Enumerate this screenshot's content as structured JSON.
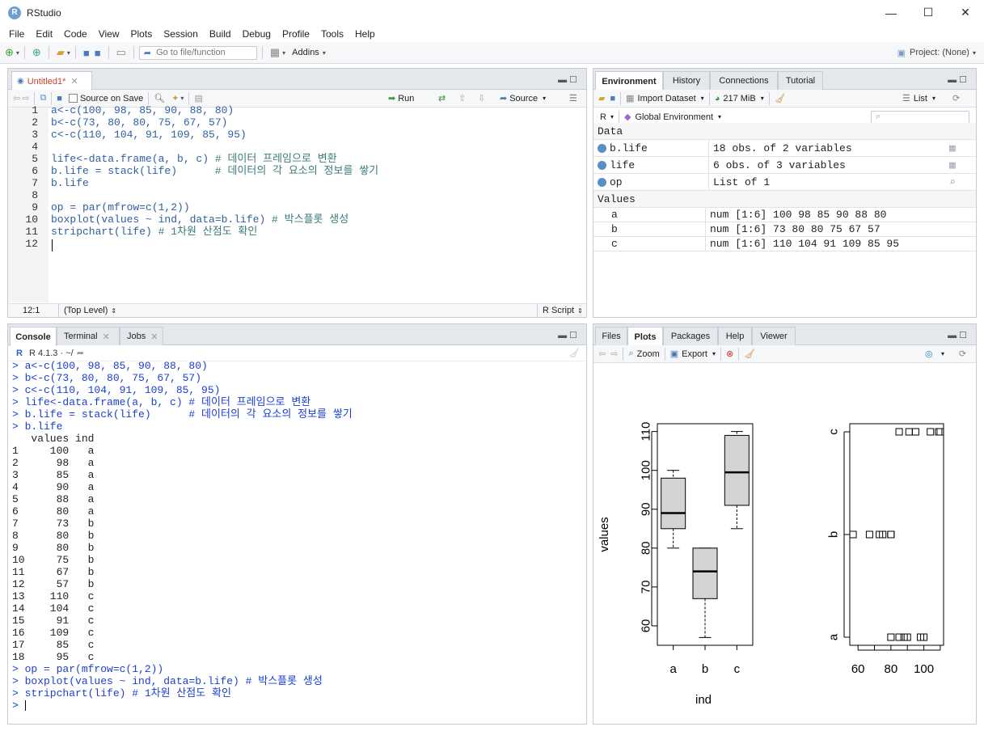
{
  "window": {
    "title": "RStudio",
    "minimize": "—",
    "maximize": "☐",
    "close": "✕"
  },
  "menu": [
    "File",
    "Edit",
    "Code",
    "View",
    "Plots",
    "Session",
    "Build",
    "Debug",
    "Profile",
    "Tools",
    "Help"
  ],
  "toolbar": {
    "goto_placeholder": "Go to file/function",
    "addins": "Addins",
    "project": "Project: (None)"
  },
  "editor": {
    "tab": "Untitled1*",
    "source_on_save": "Source on Save",
    "run": "Run",
    "source": "Source",
    "status_pos": "12:1",
    "status_scope": "(Top Level)",
    "status_type": "R Script",
    "line_numbers": [
      "1",
      "2",
      "3",
      "4",
      "5",
      "6",
      "7",
      "8",
      "9",
      "10",
      "11",
      "12"
    ],
    "lines": [
      {
        "code": "a<-c(100, 98, 85, 90, 88, 80)",
        "comment": ""
      },
      {
        "code": "b<-c(73, 80, 80, 75, 67, 57)",
        "comment": ""
      },
      {
        "code": "c<-c(110, 104, 91, 109, 85, 95)",
        "comment": ""
      },
      {
        "code": "",
        "comment": ""
      },
      {
        "code": "life<-data.frame(a, b, c) ",
        "comment": "# 데이터 프레임으로 변환"
      },
      {
        "code": "b.life = stack(life)      ",
        "comment": "# 데이터의 각 요소의 정보를 쌓기"
      },
      {
        "code": "b.life",
        "comment": ""
      },
      {
        "code": "",
        "comment": ""
      },
      {
        "code": "op = par(mfrow=c(1,2))",
        "comment": ""
      },
      {
        "code": "boxplot(values ~ ind, data=b.life) ",
        "comment": "# 박스플롯 생성"
      },
      {
        "code": "stripchart(life) ",
        "comment": "# 1차원 산점도 확인"
      },
      {
        "code": "",
        "comment": ""
      }
    ]
  },
  "environment": {
    "tabs": [
      "Environment",
      "History",
      "Connections",
      "Tutorial"
    ],
    "import_dataset": "Import Dataset",
    "memory": "217 MiB",
    "view_mode": "List",
    "lang": "R",
    "scope": "Global Environment",
    "data_header": "Data",
    "data": [
      {
        "name": "b.life",
        "value": "18 obs. of 2 variables"
      },
      {
        "name": "life",
        "value": "6 obs. of 3 variables"
      },
      {
        "name": "op",
        "value": "List of  1"
      }
    ],
    "values_header": "Values",
    "values": [
      {
        "name": "a",
        "value": "num [1:6] 100 98 85 90 88 80"
      },
      {
        "name": "b",
        "value": "num [1:6] 73 80 80 75 67 57"
      },
      {
        "name": "c",
        "value": "num [1:6] 110 104 91 109 85 95"
      }
    ]
  },
  "console": {
    "tabs": [
      "Console",
      "Terminal",
      "Jobs"
    ],
    "version": "R 4.1.3 · ~/",
    "input_lines_top": [
      "> a<-c(100, 98, 85, 90, 88, 80)",
      "> b<-c(73, 80, 80, 75, 67, 57)",
      "> c<-c(110, 104, 91, 109, 85, 95)",
      "> life<-data.frame(a, b, c) # 데이터 프레임으로 변환",
      "> b.life = stack(life)      # 데이터의 각 요소의 정보를 쌓기",
      "> b.life"
    ],
    "output_header": "   values ind",
    "output_rows": [
      "1     100   a",
      "2      98   a",
      "3      85   a",
      "4      90   a",
      "5      88   a",
      "6      80   a",
      "7      73   b",
      "8      80   b",
      "9      80   b",
      "10     75   b",
      "11     67   b",
      "12     57   b",
      "13    110   c",
      "14    104   c",
      "15     91   c",
      "16    109   c",
      "17     85   c",
      "18     95   c"
    ],
    "input_lines_bottom": [
      "> op = par(mfrow=c(1,2))",
      "> boxplot(values ~ ind, data=b.life) # 박스플롯 생성",
      "> stripchart(life) # 1차원 산점도 확인",
      "> "
    ]
  },
  "plots": {
    "tabs": [
      "Files",
      "Plots",
      "Packages",
      "Help",
      "Viewer"
    ],
    "zoom": "Zoom",
    "export": "Export"
  },
  "chart_data": [
    {
      "type": "boxplot",
      "categories": [
        "a",
        "b",
        "c"
      ],
      "xlabel": "ind",
      "ylabel": "values",
      "ylim": [
        55,
        112
      ],
      "yticks": [
        "60",
        "70",
        "80",
        "90",
        "100",
        "110"
      ],
      "series": [
        {
          "min": 80,
          "q1": 85,
          "median": 89,
          "q3": 98,
          "max": 100
        },
        {
          "min": 57,
          "q1": 67,
          "median": 74,
          "q3": 80,
          "max": 80
        },
        {
          "min": 85,
          "q1": 91,
          "median": 99.5,
          "q3": 109,
          "max": 110
        }
      ]
    },
    {
      "type": "scatter",
      "xlabel": "",
      "ylabel": "",
      "categories": [
        "a",
        "b",
        "c"
      ],
      "xticks": [
        "60",
        "80",
        "100"
      ],
      "xlim": [
        55,
        112
      ],
      "series": [
        {
          "name": "a",
          "values": [
            100,
            98,
            85,
            90,
            88,
            80
          ]
        },
        {
          "name": "b",
          "values": [
            73,
            80,
            80,
            75,
            67,
            57
          ]
        },
        {
          "name": "c",
          "values": [
            110,
            104,
            91,
            109,
            85,
            95
          ]
        }
      ]
    }
  ]
}
